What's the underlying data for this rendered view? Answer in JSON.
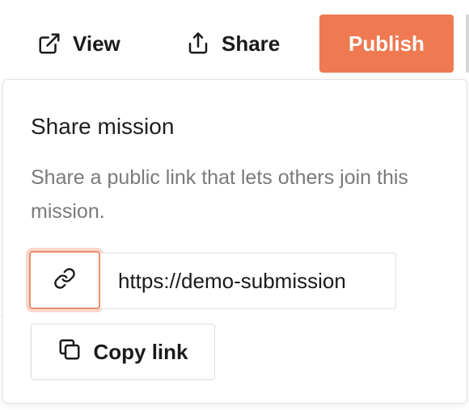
{
  "toolbar": {
    "view_label": "View",
    "share_label": "Share",
    "publish_label": "Publish"
  },
  "popover": {
    "title": "Share mission",
    "description": "Share a public link that lets others join this mission.",
    "link_value": "https://demo-submission",
    "copy_label": "Copy link"
  },
  "icons": {
    "view": "external-link-icon",
    "share": "share-upload-icon",
    "link": "link-chain-icon",
    "copy": "copy-icon"
  },
  "colors": {
    "publish_bg": "#ef7a51",
    "focus_ring": "#e8906e",
    "muted_text": "#7a7a7a"
  }
}
